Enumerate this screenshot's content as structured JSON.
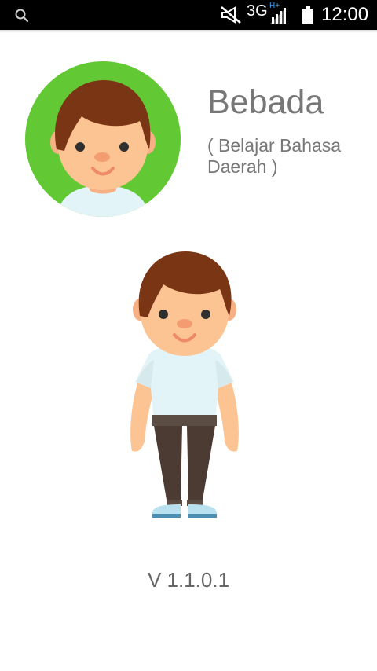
{
  "status_bar": {
    "network": "3G",
    "network_sub": "H+",
    "time": "12:00",
    "icons": [
      "search-icon",
      "mute-icon",
      "signal-icon",
      "battery-icon"
    ]
  },
  "app": {
    "title": "Bebada",
    "subtitle": "( Belajar Bahasa Daerah )",
    "version": "V 1.1.0.1"
  },
  "colors": {
    "status_bar_bg": "#000000",
    "avatar_bg": "#62c935",
    "text_gray": "#777777"
  }
}
